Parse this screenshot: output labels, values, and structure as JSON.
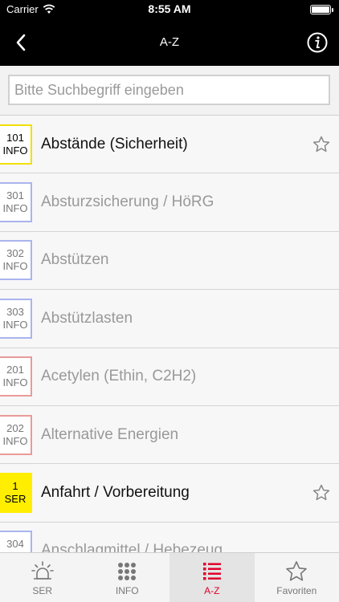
{
  "status": {
    "carrier": "Carrier",
    "time": "8:55 AM"
  },
  "nav": {
    "title": "A-Z",
    "back_icon": "chevron-left-icon",
    "info_icon": "info-circle-icon"
  },
  "search": {
    "placeholder": "Bitte Suchbegriff eingeben",
    "value": ""
  },
  "list": {
    "items": [
      {
        "num": "101",
        "type": "INFO",
        "label": "Abstände (Sicherheit)",
        "color": "#f0e000",
        "favorite_icon": true
      },
      {
        "num": "301",
        "type": "INFO",
        "label": "Absturzsicherung / HöRG",
        "color": "#aab4ee"
      },
      {
        "num": "302",
        "type": "INFO",
        "label": "Abstützen",
        "color": "#aab4ee"
      },
      {
        "num": "303",
        "type": "INFO",
        "label": "Abstützlasten",
        "color": "#aab4ee"
      },
      {
        "num": "201",
        "type": "INFO",
        "label": "Acetylen (Ethin, C2H2)",
        "color": "#e99a9a"
      },
      {
        "num": "202",
        "type": "INFO",
        "label": "Alternative Energien",
        "color": "#e99a9a"
      },
      {
        "num": "1",
        "type": "SER",
        "label": "Anfahrt / Vorbereitung",
        "color": "#ffee00",
        "favorite_icon": true
      },
      {
        "num": "304",
        "type": "INFO",
        "label": "Anschlagmittel / Hebezeug",
        "color": "#aab4ee"
      }
    ]
  },
  "tabs": [
    {
      "label": "SER",
      "icon": "siren-icon"
    },
    {
      "label": "INFO",
      "icon": "grid-icon"
    },
    {
      "label": "A-Z",
      "icon": "list-icon",
      "selected": true
    },
    {
      "label": "Favoriten",
      "icon": "star-icon"
    }
  ]
}
